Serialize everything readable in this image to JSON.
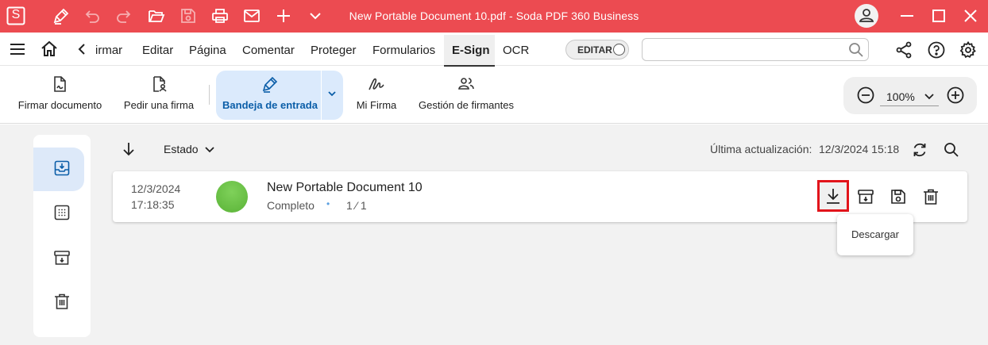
{
  "titlebar": {
    "app_letter": "S",
    "title": "New Portable Document 10.pdf   -   Soda PDF 360 Business",
    "accent": "#ec4b51"
  },
  "menubar": {
    "tabs": [
      {
        "label": "irmar",
        "active": false
      },
      {
        "label": "Editar",
        "active": false
      },
      {
        "label": "Página",
        "active": false
      },
      {
        "label": "Comentar",
        "active": false
      },
      {
        "label": "Proteger",
        "active": false
      },
      {
        "label": "Formularios",
        "active": false
      },
      {
        "label": "E-Sign",
        "active": true
      },
      {
        "label": "OCR",
        "active": false
      }
    ],
    "edit_toggle_label": "EDITAR",
    "search_value": ""
  },
  "ribbon": {
    "firmar_documento": "Firmar documento",
    "pedir_firma": "Pedir una firma",
    "bandeja": "Bandeja de entrada",
    "mi_firma": "Mi Firma",
    "gestion": "Gestión de firmantes",
    "zoom_value": "100%"
  },
  "list": {
    "sort_label": "Estado",
    "last_update_label": "Última actualización:",
    "last_update_value": "12/3/2024 15:18"
  },
  "document": {
    "date": "12/3/2024",
    "time": "17:18:35",
    "name": "New Portable Document 10",
    "status": "Completo",
    "separator": "•",
    "signatures": "1 ⁄ 1",
    "status_color": "#6cc24a"
  },
  "tooltip": {
    "text": "Descargar"
  },
  "icons": {
    "titlebar": [
      "app-logo-icon",
      "pen-icon",
      "undo-icon",
      "redo-icon",
      "open-folder-icon",
      "save-icon",
      "print-icon",
      "mail-icon",
      "plus-icon",
      "chevron-down-icon",
      "user-icon",
      "minimize-icon",
      "maximize-icon",
      "close-icon"
    ],
    "row_actions": [
      "download-icon",
      "archive-icon",
      "save-icon",
      "trash-icon"
    ]
  }
}
